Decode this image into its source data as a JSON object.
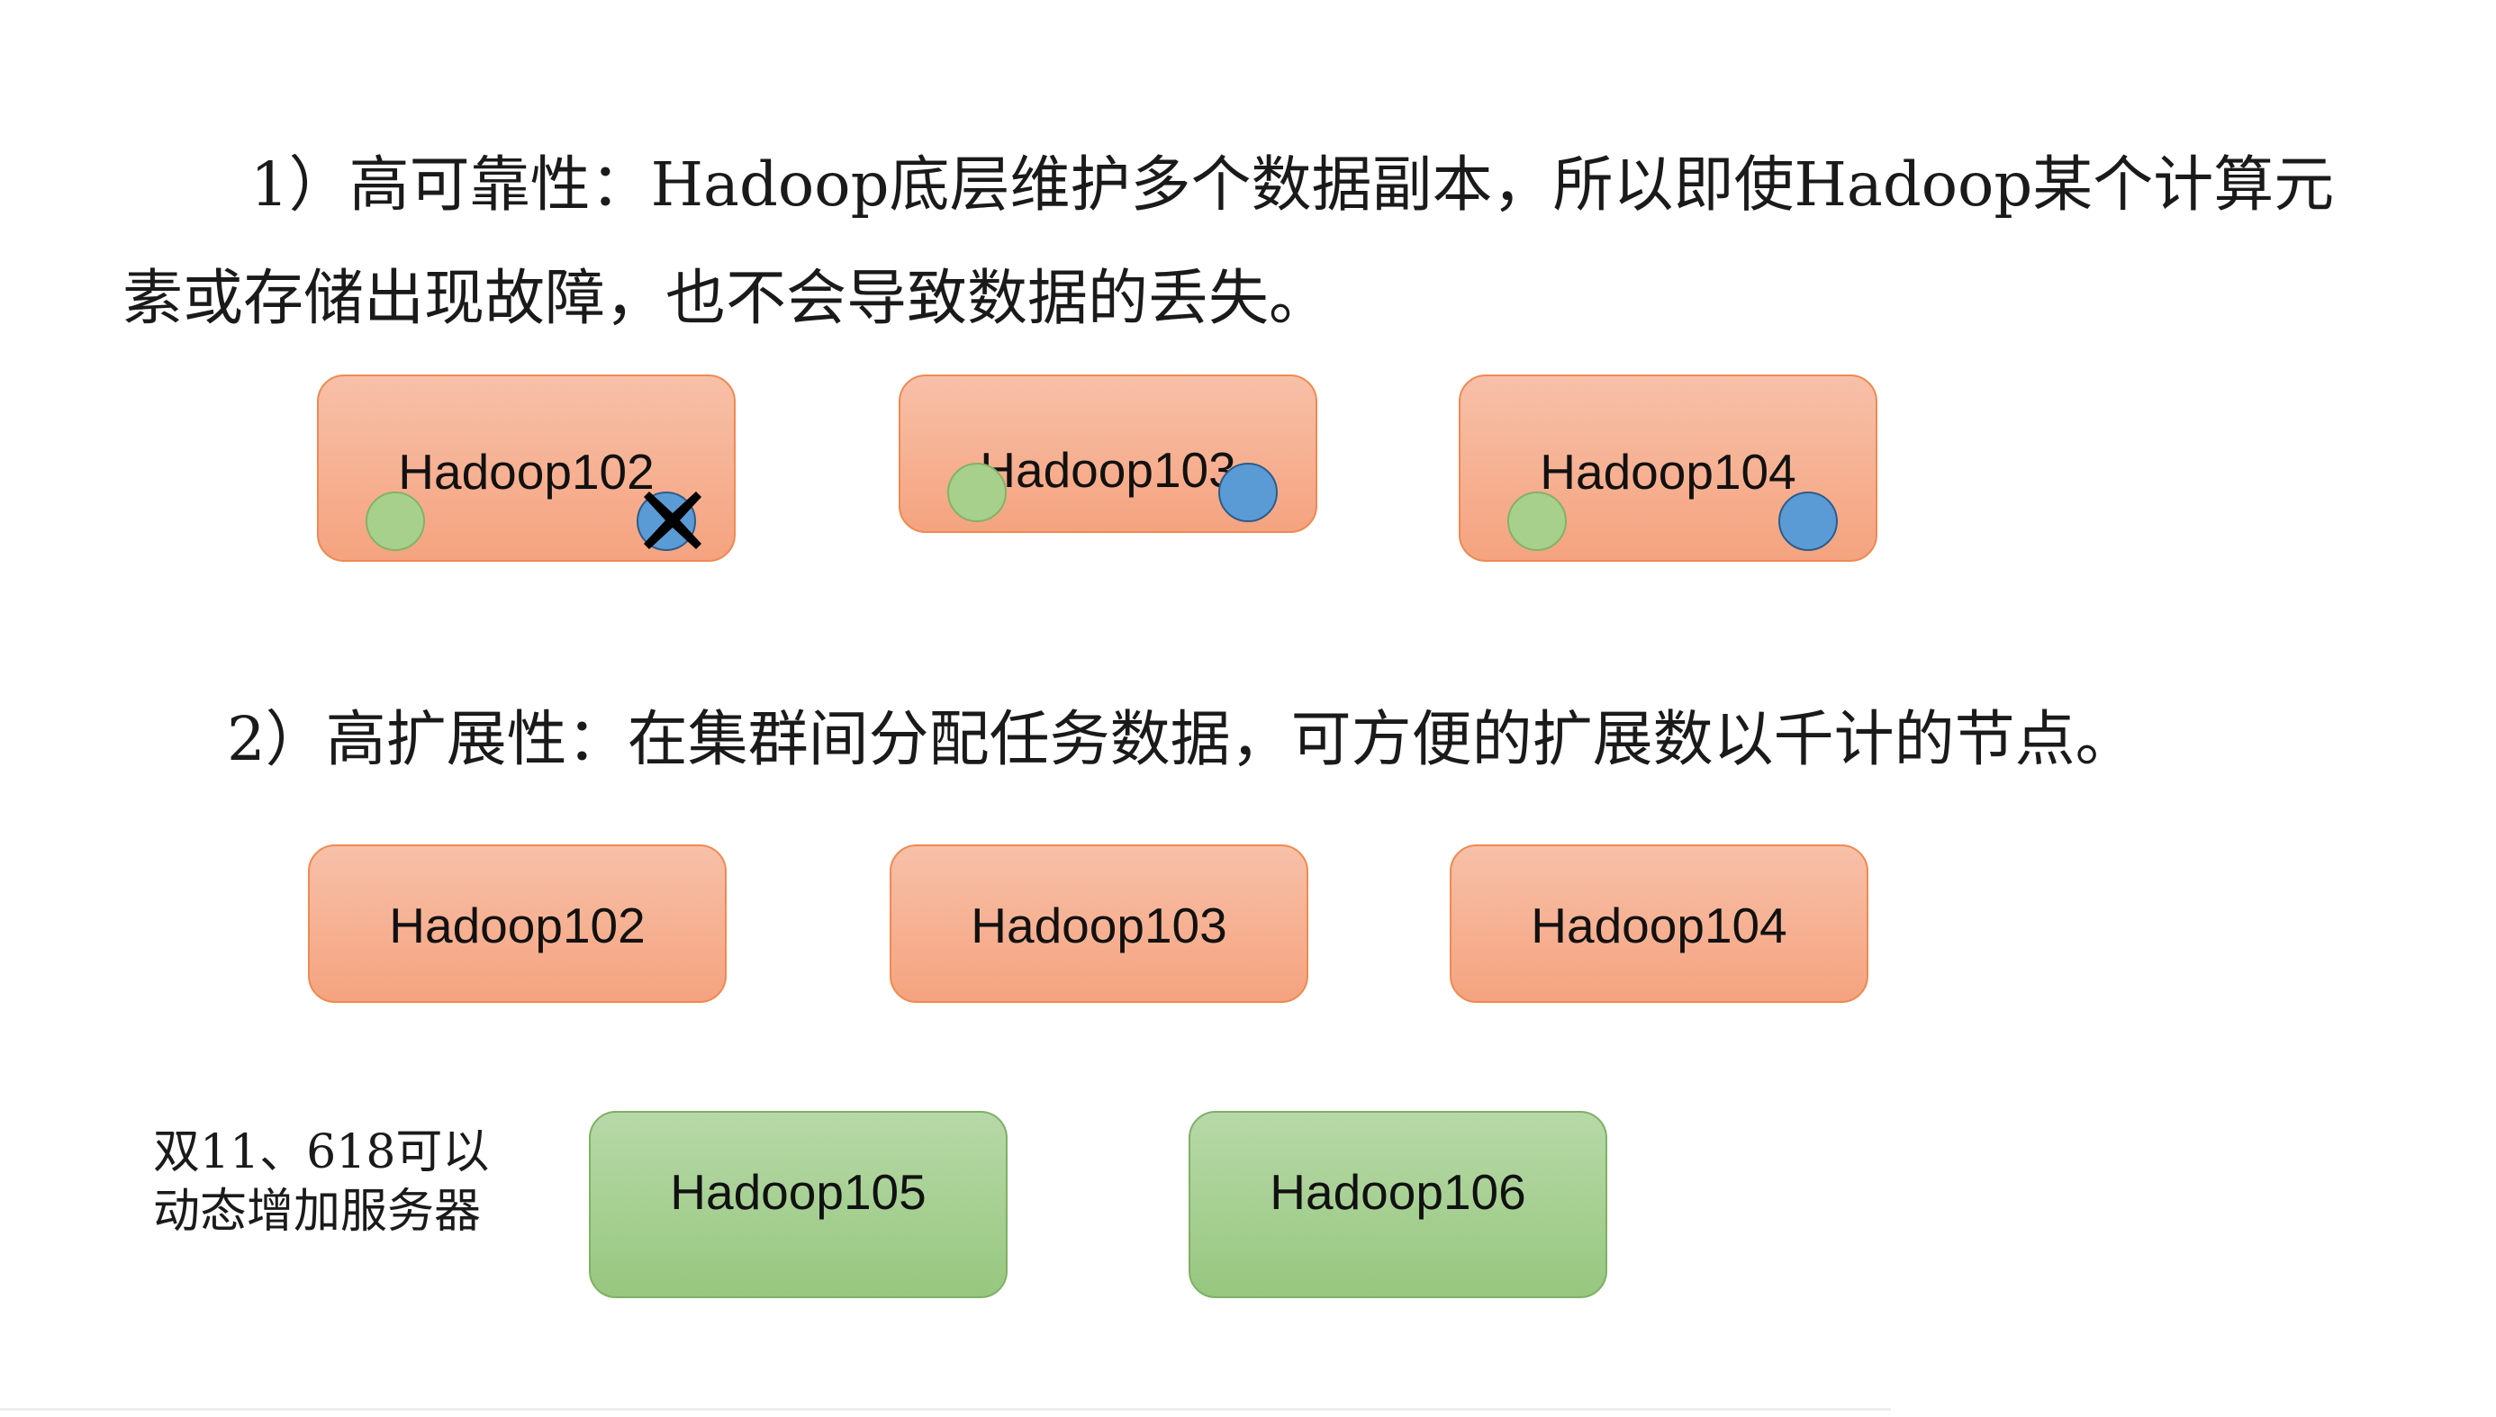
{
  "text": {
    "point1_line1": "1）高可靠性：Hadoop底层维护多个数据副本，所以即使Hadoop某个计算元",
    "point1_line2": "素或存储出现故障，也不会导致数据的丢失。",
    "point2": "2）高扩展性：在集群间分配任务数据，可方便的扩展数以千计的节点。",
    "note_line1": "双11、618可以",
    "note_line2": "动态增加服务器"
  },
  "reliability_nodes": [
    {
      "label": "Hadoop102",
      "blue_replica": "failed"
    },
    {
      "label": "Hadoop103",
      "blue_replica": "ok"
    },
    {
      "label": "Hadoop104",
      "blue_replica": "ok"
    }
  ],
  "scaling_nodes": [
    {
      "label": "Hadoop102"
    },
    {
      "label": "Hadoop103"
    },
    {
      "label": "Hadoop104"
    }
  ],
  "added_nodes": [
    {
      "label": "Hadoop105"
    },
    {
      "label": "Hadoop106"
    }
  ],
  "colors": {
    "node_orange": "#f5a37f",
    "node_orange_border": "#ee8a52",
    "node_green": "#97c77f",
    "replica_green": "#a8d08d",
    "replica_blue": "#5b9bd5",
    "failure_mark": "#000000"
  }
}
